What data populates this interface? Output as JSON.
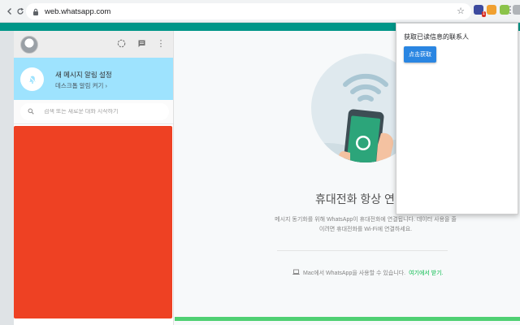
{
  "browser": {
    "url": "web.whatsapp.com",
    "nav_icons": [
      "back-icon",
      "reload-icon"
    ],
    "extension_badge": "1"
  },
  "sidebar": {
    "header_icons": [
      "status-icon",
      "new-chat-icon",
      "menu-icon"
    ],
    "notification": {
      "title": "새 메시지 알림 설정",
      "link": "데스크톱 알림 켜기 ›"
    },
    "search": {
      "placeholder": "검색 또는 새로운 대화 시작하기"
    }
  },
  "intro": {
    "title": "휴대전화 항상 연결",
    "text": "메시지 동기화를 위해 WhatsApp이 휴대전화에 연결됩니다. 데이터 사용을 줄이려면 휴대전화를 Wi-Fi에 연결하세요.",
    "mac_text": "Mac에서 WhatsApp을 사용할 수 있습니다.",
    "mac_link": "여기에서 받기."
  },
  "popup": {
    "title": "获取已读信息的联系人",
    "button_label": "点击获取"
  },
  "colors": {
    "teal": "#009688",
    "notification_bg": "#9ee3fe",
    "redacted": "#ee4123",
    "green": "#4fd073",
    "button_blue": "#2a86e2"
  }
}
